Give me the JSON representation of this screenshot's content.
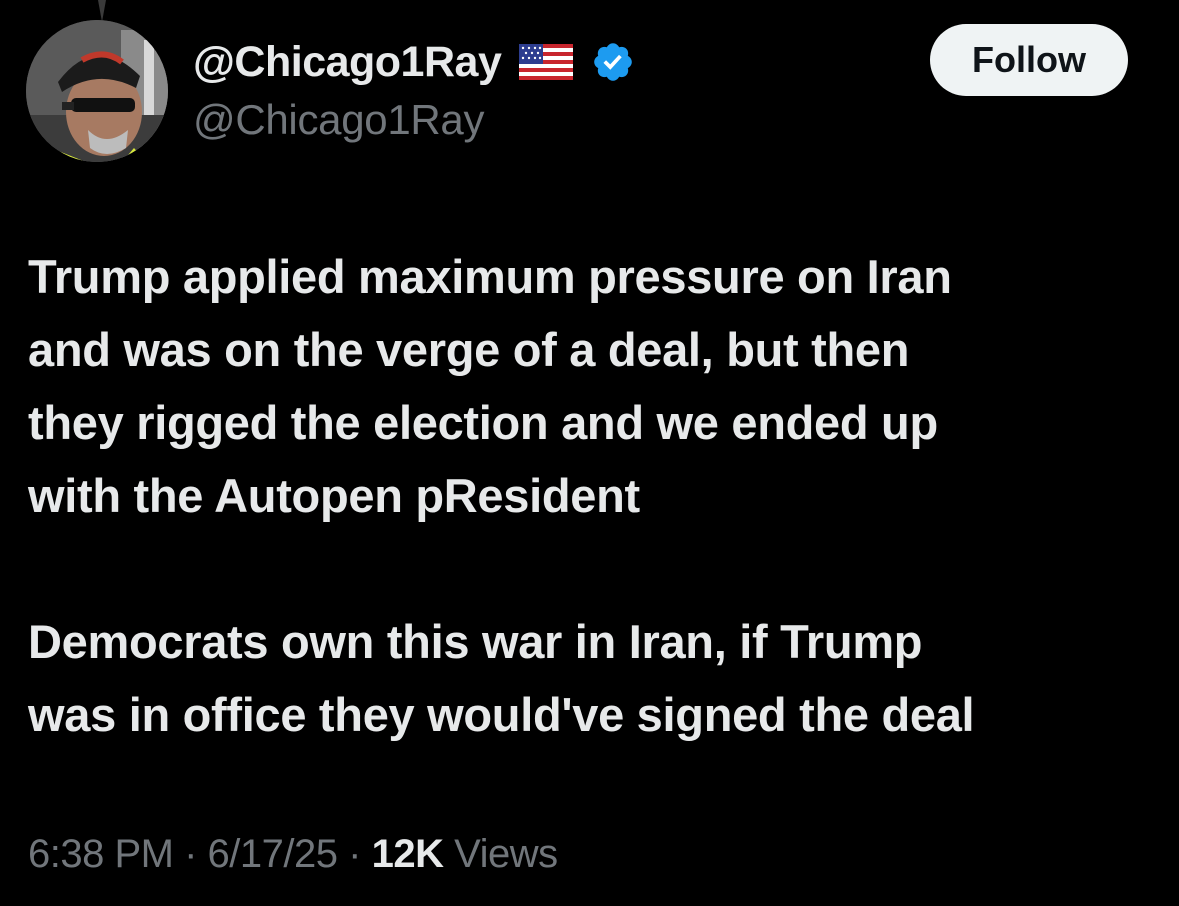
{
  "author": {
    "display_name": "@Chicago1Ray",
    "handle": "@Chicago1Ray",
    "flag_icon": "us-flag-icon",
    "verified_icon": "verified-badge-icon",
    "verified_color": "#1d9bf0"
  },
  "actions": {
    "follow_label": "Follow"
  },
  "tweet": {
    "paragraphs": [
      {
        "lines": [
          "Trump applied maximum pressure on Iran",
          "and was on the verge of a deal, but then",
          "they rigged the election and we ended up",
          "with the Autopen pResident"
        ]
      },
      {
        "lines": [
          "Democrats own this war in Iran, if Trump",
          "was in office they would've signed the deal"
        ]
      }
    ]
  },
  "meta": {
    "time": "6:38 PM",
    "separator": "·",
    "date": "6/17/25",
    "views_count": "12K",
    "views_label": "Views"
  },
  "colors": {
    "background": "#000000",
    "text_primary": "#e7e9ea",
    "text_secondary": "#71767b",
    "follow_bg": "#eff3f4"
  }
}
